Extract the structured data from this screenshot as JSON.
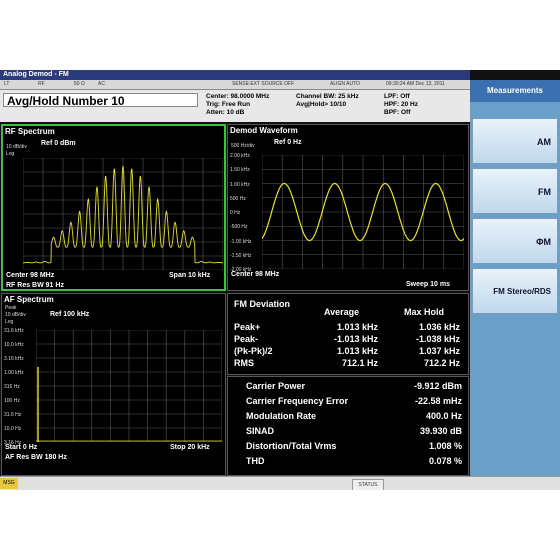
{
  "titlebar": {
    "app": "Analog Demod - FM"
  },
  "strip": {
    "items": [
      "LT",
      "RF",
      "50 Ω",
      "AC",
      "SENSE:EXT SOURCE OFF",
      "ALIGN AUTO",
      "09:30:24 AM Dec 13, 2011"
    ]
  },
  "info": {
    "avg": "Avg/Hold Number 10",
    "center": "Center: 98.0000 MHz",
    "trig": "Trig: Free Run",
    "atten": "Atten: 10 dB",
    "chbw": "Channel BW: 25 kHz",
    "avghold": "Avg|Hold> 10/10",
    "lpf": "LPF: Off",
    "hpf": "HPF: 20 Hz",
    "bpf": "BPF: Off"
  },
  "rf": {
    "title": "RF Spectrum",
    "scale": "10 dB/div",
    "log": "Log",
    "ref": "Ref  0 dBm",
    "center": "Center  98 MHz",
    "span": "Span 10 kHz",
    "rbw": "RF Res BW  91 Hz"
  },
  "demod": {
    "title": "Demod Waveform",
    "scale": "500 Hz/div",
    "ref": "Ref  0 Hz",
    "center": "Center  98 MHz",
    "sweep": "Sweep  10 ms",
    "yticks": [
      "2.00 kHz",
      "1.50 kHz",
      "1.00 kHz",
      "500 Hz",
      "0 Hz",
      "-500 Hz",
      "-1.00 kHz",
      "-1.50 kHz",
      "-2.00 kHz"
    ]
  },
  "af": {
    "title": "AF Spectrum",
    "peak": "Peak",
    "scale": "10 dB/div",
    "log": "Log",
    "ref": "Ref 100 kHz",
    "start": "Start  0 Hz",
    "stop": "Stop 20 kHz",
    "rbw": "AF Res BW  180 Hz",
    "yticks": [
      "31.6 kHz",
      "10.0 kHz",
      "3.16 kHz",
      "1.00 kHz",
      "316 Hz",
      "100 Hz",
      "31.6 Hz",
      "10.0 Hz",
      "3.16 Hz"
    ]
  },
  "fm": {
    "title": "FM Deviation",
    "col_avg": "Average",
    "col_max": "Max Hold",
    "rows": [
      {
        "label": "Peak+",
        "avg": "1.013 kHz",
        "max": "1.036 kHz"
      },
      {
        "label": "Peak-",
        "avg": "-1.013 kHz",
        "max": "-1.038 kHz"
      },
      {
        "label": "(Pk-Pk)/2",
        "avg": "1.013 kHz",
        "max": "1.037 kHz"
      },
      {
        "label": "RMS",
        "avg": "712.1 Hz",
        "max": "712.2 Hz"
      }
    ]
  },
  "meas": [
    {
      "label": "Carrier Power",
      "value": "-9.912 dBm"
    },
    {
      "label": "Carrier Frequency Error",
      "value": "-22.58 mHz"
    },
    {
      "label": "Modulation Rate",
      "value": "400.0 Hz"
    },
    {
      "label": "SINAD",
      "value": "39.930 dB"
    },
    {
      "label": "Distortion/Total Vrms",
      "value": "1.008 %"
    },
    {
      "label": "THD",
      "value": "0.078 %"
    }
  ],
  "softkeys": {
    "title": "Measurements",
    "keys": [
      "AM",
      "FM",
      "ΦM",
      "FM Stereo/RDS"
    ]
  },
  "bottom": {
    "msg": "MSG",
    "status": "STATUS"
  },
  "colors": {
    "trace": "#e8e030",
    "grid": "#5a5a5a",
    "active_border": "#40c040"
  }
}
